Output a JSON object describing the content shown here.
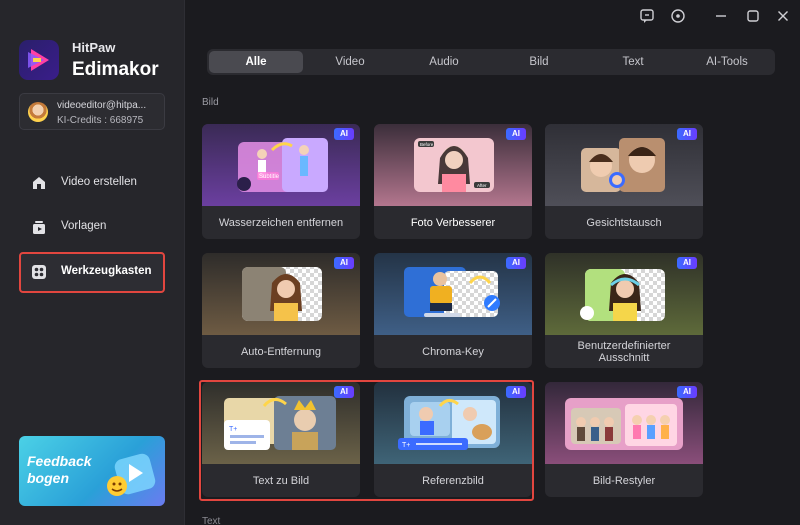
{
  "brand": {
    "line1": "HitPaw",
    "line2": "Edimakor"
  },
  "account": {
    "email": "videoeditor@hitpa...",
    "credits": "KI-Credits : 668975"
  },
  "nav": [
    {
      "label": "Video erstellen",
      "icon": "home-icon"
    },
    {
      "label": "Vorlagen",
      "icon": "template-icon"
    },
    {
      "label": "Werkzeugkasten",
      "icon": "toolbox-icon",
      "active": true
    }
  ],
  "feedback": {
    "line1": "Feedback",
    "line2": "bogen"
  },
  "titlebar": {
    "icons": [
      "feedback-chat-icon",
      "settings-icon",
      "minimize-icon",
      "maximize-icon",
      "close-icon"
    ]
  },
  "tabs": [
    {
      "label": "Alle",
      "active": true
    },
    {
      "label": "Video"
    },
    {
      "label": "Audio"
    },
    {
      "label": "Bild"
    },
    {
      "label": "Text"
    },
    {
      "label": "AI-Tools"
    }
  ],
  "sections": {
    "bild": "Bild",
    "text": "Text"
  },
  "ai_badge": "AI",
  "cards": [
    {
      "label": "Wasserzeichen entfernen",
      "badge": "AI"
    },
    {
      "label": "Foto Verbesserer",
      "badge": "AI"
    },
    {
      "label": "Gesichtstausch",
      "badge": "AI"
    },
    {
      "label": "Auto-Entfernung",
      "badge": "AI"
    },
    {
      "label": "Chroma-Key",
      "badge": "AI"
    },
    {
      "label": "Benutzerdefinierter Ausschnitt",
      "badge": "AI"
    },
    {
      "label": "Text zu Bild",
      "badge": "AI"
    },
    {
      "label": "Referenzbild",
      "badge": "AI"
    },
    {
      "label": "Bild-Restyler",
      "badge": "AI"
    }
  ],
  "thumb_text": {
    "subtitle": "Subtitle",
    "before": "Before",
    "after": "After",
    "t_plus": "T+"
  },
  "colors": {
    "accent_red": "#e2463f",
    "ai_blue": "#3b6bff",
    "bg": "#1b1b1f",
    "sidebar": "#26262b"
  }
}
